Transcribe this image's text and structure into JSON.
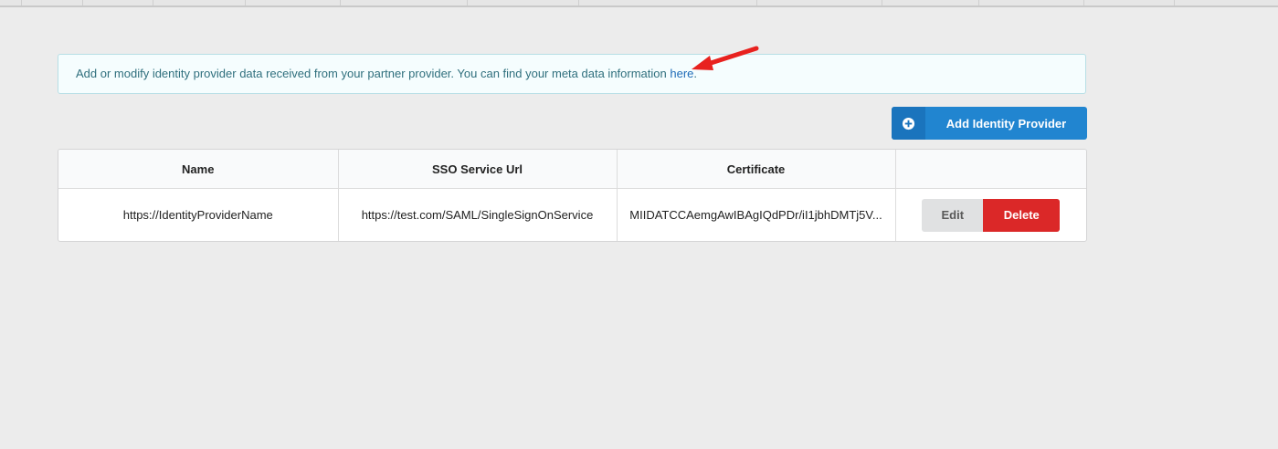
{
  "info": {
    "text": "Add or modify identity provider data received from your partner provider. You can find your meta data information ",
    "link_label": "here",
    "suffix": "."
  },
  "toolbar": {
    "add_label": "Add Identity Provider",
    "add_icon": "plus-circle-icon"
  },
  "table": {
    "headers": {
      "name": "Name",
      "sso_url": "SSO Service Url",
      "certificate": "Certificate",
      "actions": ""
    },
    "rows": [
      {
        "name": "https://IdentityProviderName",
        "sso_url": "https://test.com/SAML/SingleSignOnService",
        "certificate": "MIIDATCCAemgAwIBAgIQdPDr/iI1jbhDMTj5V...",
        "edit_label": "Edit",
        "delete_label": "Delete"
      }
    ]
  },
  "annotation": {
    "arrow_icon": "red-arrow-icon",
    "arrow_color": "#e8221f"
  },
  "colors": {
    "primary": "#2185d0",
    "danger": "#db2828",
    "info_border": "#b7dfe6",
    "info_text": "#2f6f7d"
  }
}
